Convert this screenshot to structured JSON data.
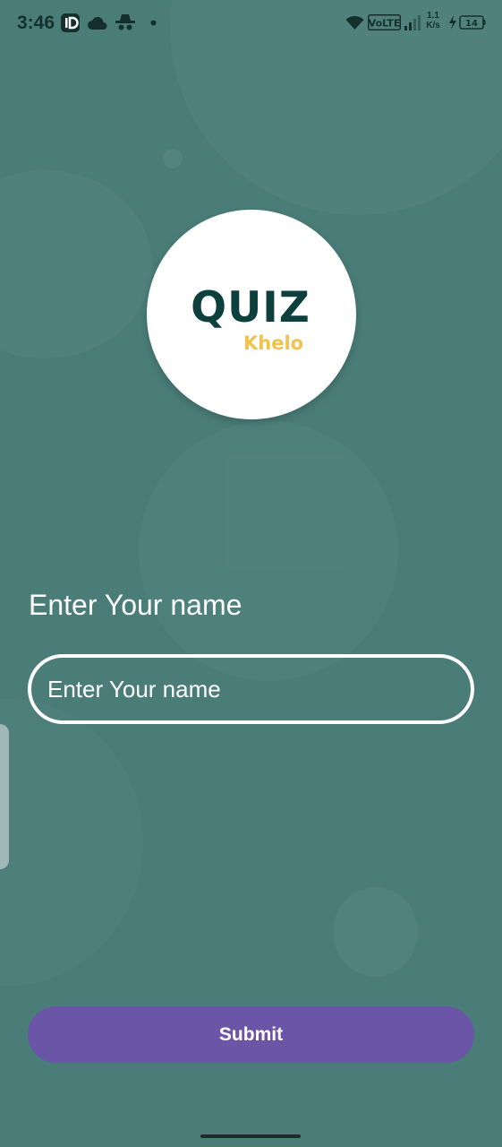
{
  "status_bar": {
    "time": "3:46",
    "network_type": "VoLTE",
    "net_speed_value": "1.1",
    "net_speed_unit": "K/s",
    "battery_level": "14",
    "icons": [
      "id-app-icon",
      "cloud-icon",
      "spy-icon",
      "notification-dot-icon",
      "wifi-icon",
      "volte-icon",
      "signal-icon",
      "battery-charging-icon"
    ]
  },
  "logo": {
    "title": "QUIZ",
    "subtitle": "Khelo",
    "colors": {
      "title": "#0d3f3c",
      "subtitle": "#f2c24e"
    }
  },
  "form": {
    "label": "Enter Your name",
    "input_placeholder": "Enter Your name",
    "input_value": ""
  },
  "actions": {
    "submit_label": "Submit"
  },
  "theme": {
    "background": "#4a7d78",
    "button": "#6a55a6"
  }
}
